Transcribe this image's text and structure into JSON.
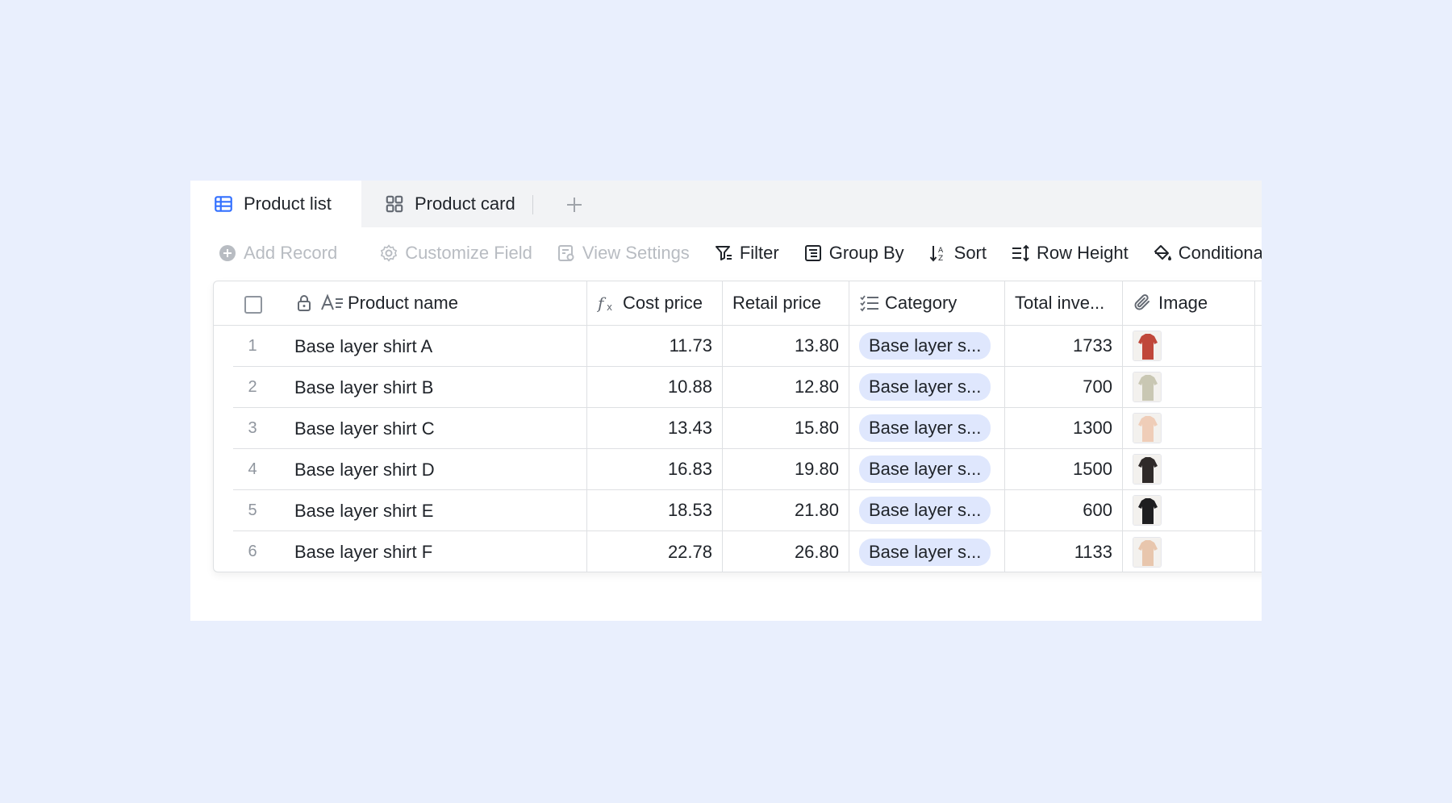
{
  "tabs": [
    {
      "label": "Product list",
      "icon": "grid-table-icon",
      "active": true
    },
    {
      "label": "Product card",
      "icon": "card-grid-icon",
      "active": false
    }
  ],
  "toolbar": {
    "add_record": "Add Record",
    "customize_field": "Customize Field",
    "view_settings": "View Settings",
    "filter": "Filter",
    "group_by": "Group By",
    "sort": "Sort",
    "row_height": "Row Height",
    "conditional": "Conditiona"
  },
  "columns": {
    "product_name": "Product name",
    "cost_price": "Cost price",
    "retail_price": "Retail price",
    "category": "Category",
    "total_inventory": "Total inve...",
    "image": "Image"
  },
  "rows": [
    {
      "num": "1",
      "name": "Base layer shirt A",
      "cost": "11.73",
      "retail": "13.80",
      "category": "Base layer s...",
      "inventory": "1733",
      "thumb_color": "#c0473a"
    },
    {
      "num": "2",
      "name": "Base layer shirt B",
      "cost": "10.88",
      "retail": "12.80",
      "category": "Base layer s...",
      "inventory": "700",
      "thumb_color": "#c9c7b3"
    },
    {
      "num": "3",
      "name": "Base layer shirt C",
      "cost": "13.43",
      "retail": "15.80",
      "category": "Base layer s...",
      "inventory": "1300",
      "thumb_color": "#efcdb8"
    },
    {
      "num": "4",
      "name": "Base layer shirt D",
      "cost": "16.83",
      "retail": "19.80",
      "category": "Base layer s...",
      "inventory": "1500",
      "thumb_color": "#2f2a29"
    },
    {
      "num": "5",
      "name": "Base layer shirt E",
      "cost": "18.53",
      "retail": "21.80",
      "category": "Base layer s...",
      "inventory": "600",
      "thumb_color": "#1e1e20"
    },
    {
      "num": "6",
      "name": "Base layer shirt F",
      "cost": "22.78",
      "retail": "26.80",
      "category": "Base layer s...",
      "inventory": "1133",
      "thumb_color": "#e8c6ad"
    }
  ],
  "colors": {
    "accent": "#3370ff",
    "pill_bg": "#dfe7fd",
    "page_bg": "#e9effd"
  }
}
